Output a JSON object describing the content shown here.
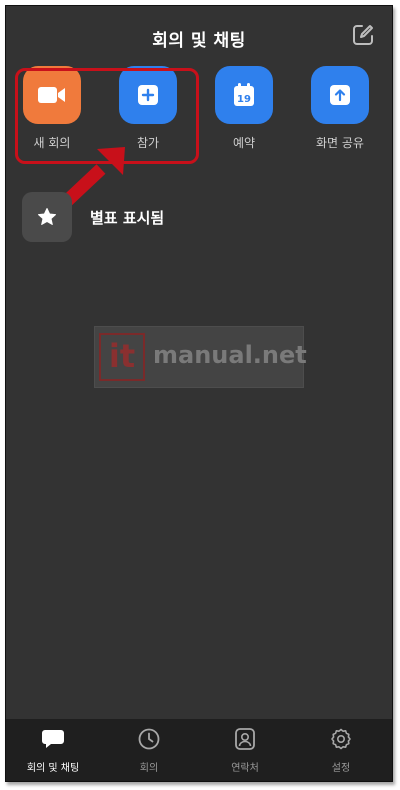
{
  "header": {
    "title": "회의 및 채팅"
  },
  "actions": [
    {
      "label": "새 회의",
      "icon": "video-camera-icon",
      "color": "#f07a3c"
    },
    {
      "label": "참가",
      "icon": "plus-icon",
      "color": "#2f80ed"
    },
    {
      "label": "예약",
      "icon": "calendar-icon",
      "color": "#2f80ed",
      "icon_text": "19"
    },
    {
      "label": "화면 공유",
      "icon": "upload-icon",
      "color": "#2f80ed"
    }
  ],
  "starred": {
    "label": "별표 표시됨",
    "icon": "star-icon"
  },
  "watermark": {
    "it": "it",
    "text": "manual.net"
  },
  "tabs": [
    {
      "label": "회의 및 채팅",
      "icon": "chat-bubble-icon",
      "active": true
    },
    {
      "label": "회의",
      "icon": "clock-icon"
    },
    {
      "label": "연락처",
      "icon": "contact-icon"
    },
    {
      "label": "설정",
      "icon": "gear-icon"
    }
  ],
  "colors": {
    "background": "#333333",
    "tabbar": "#1f1f1f",
    "highlight": "#c8101a"
  }
}
